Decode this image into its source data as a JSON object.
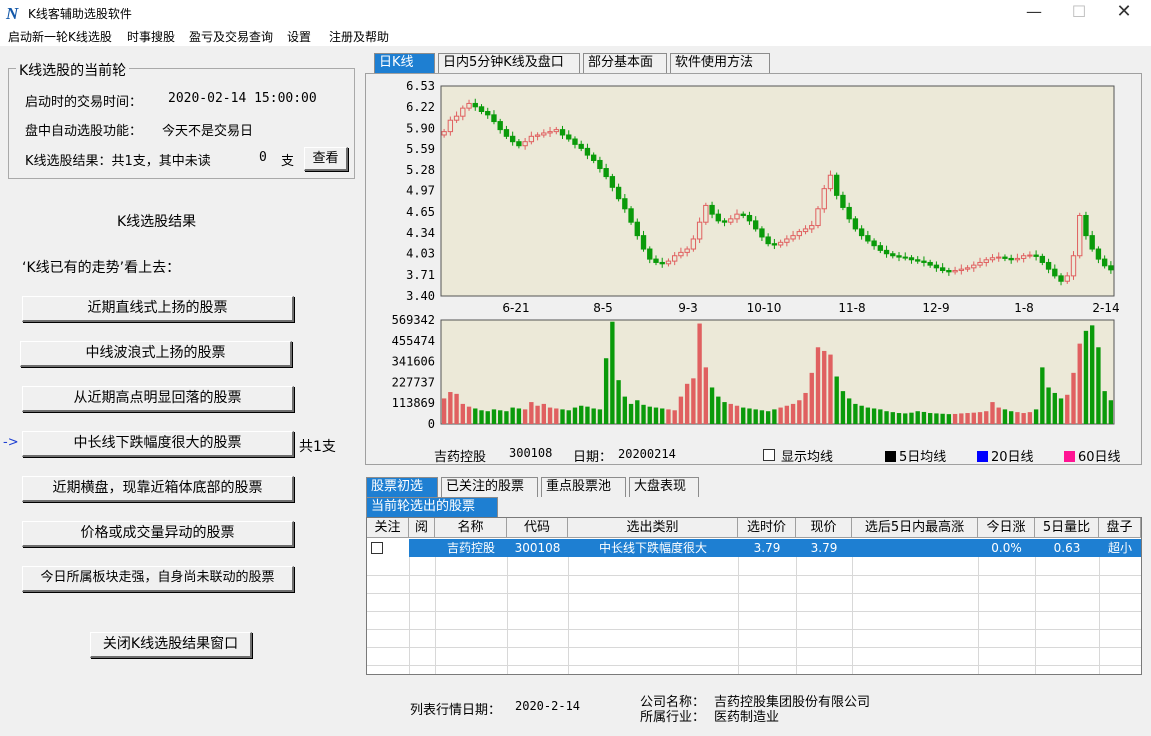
{
  "window": {
    "title": "K线客辅助选股软件",
    "logo": "N"
  },
  "menu": [
    "启动新一轮K线选股",
    "时事搜股",
    "盈亏及交易查询",
    "设置",
    "注册及帮助"
  ],
  "round": {
    "title": "K线选股的当前轮",
    "start_time_label": "启动时的交易时间：",
    "start_time": "2020-02-14 15:00:00",
    "auto_label": "盘中自动选股功能：",
    "auto_value": "今天不是交易日",
    "result_label": "K线选股结果：共1支，其中未读",
    "unread": "0",
    "unit": "支",
    "view_button": "查看"
  },
  "results": {
    "title": "K线选股结果",
    "intro": "‘K线已有的走势’看上去：",
    "marker": "->",
    "buttons": [
      {
        "label": "近期直线式上扬的股票",
        "count": ""
      },
      {
        "label": "中线波浪式上扬的股票",
        "count": ""
      },
      {
        "label": "从近期高点明显回落的股票",
        "count": ""
      },
      {
        "label": "中长线下跌幅度很大的股票",
        "count": "共1支"
      },
      {
        "label": "近期横盘，现靠近箱体底部的股票",
        "count": ""
      },
      {
        "label": "价格或成交量异动的股票",
        "count": ""
      },
      {
        "label": "今日所属板块走强，自身尚未联动的股票",
        "count": ""
      }
    ],
    "close_button": "关闭K线选股结果窗口"
  },
  "chart_tabs": [
    "日K线",
    "日内5分钟K线及盘口",
    "部分基本面",
    "软件使用方法"
  ],
  "chart_info": {
    "name": "吉药控股",
    "code": "300108",
    "date_label": "日期：",
    "date": "20200214",
    "show_ma": "显示均线",
    "ma5": "5日均线",
    "ma20": "20日线",
    "ma60": "60日线"
  },
  "colors": {
    "up": "#e06060",
    "down": "#0a9a0a",
    "plot_bg": "#ece9d8",
    "ma5": "#000000",
    "ma20": "#0000ff",
    "ma60": "#ff1493",
    "accent": "#1e7fd2"
  },
  "chart_data": [
    {
      "type": "candlestick",
      "y_ticks": [
        "6.53",
        "6.22",
        "5.90",
        "5.59",
        "5.28",
        "4.97",
        "4.65",
        "4.34",
        "4.03",
        "3.71",
        "3.40"
      ],
      "ylim": [
        3.4,
        6.53
      ],
      "x_ticks": [
        "6-21",
        "8-5",
        "9-3",
        "10-10",
        "11-8",
        "12-9",
        "1-8",
        "2-14"
      ],
      "close": [
        5.85,
        6.02,
        6.08,
        6.2,
        6.27,
        6.22,
        6.15,
        6.1,
        6.0,
        5.88,
        5.78,
        5.7,
        5.64,
        5.7,
        5.78,
        5.8,
        5.83,
        5.85,
        5.88,
        5.8,
        5.74,
        5.66,
        5.6,
        5.5,
        5.42,
        5.3,
        5.18,
        5.02,
        4.85,
        4.7,
        4.5,
        4.3,
        4.1,
        3.95,
        3.9,
        3.88,
        3.92,
        4.0,
        4.05,
        4.1,
        4.25,
        4.5,
        4.75,
        4.62,
        4.52,
        4.5,
        4.55,
        4.62,
        4.6,
        4.52,
        4.4,
        4.28,
        4.18,
        4.16,
        4.2,
        4.25,
        4.3,
        4.36,
        4.4,
        4.45,
        4.7,
        5.0,
        5.2,
        4.9,
        4.72,
        4.55,
        4.4,
        4.3,
        4.22,
        4.15,
        4.08,
        4.03,
        4.0,
        3.98,
        3.97,
        3.94,
        3.92,
        3.9,
        3.86,
        3.82,
        3.78,
        3.76,
        3.78,
        3.8,
        3.82,
        3.86,
        3.9,
        3.94,
        3.97,
        3.98,
        3.96,
        3.94,
        3.96,
        4.0,
        4.01,
        3.99,
        3.9,
        3.8,
        3.7,
        3.62,
        3.7,
        4.0,
        4.6,
        4.3,
        4.1,
        3.95,
        3.85,
        3.79
      ],
      "volume_y_ticks": [
        "569342",
        "455474",
        "341606",
        "227737",
        "113869",
        "0"
      ],
      "volume_ylim": [
        0,
        569342
      ],
      "volume": [
        140000,
        175000,
        165000,
        110000,
        95000,
        85000,
        75000,
        70000,
        80000,
        75000,
        70000,
        90000,
        85000,
        80000,
        120000,
        100000,
        110000,
        90000,
        85000,
        80000,
        75000,
        90000,
        100000,
        95000,
        85000,
        80000,
        360000,
        560000,
        240000,
        150000,
        110000,
        130000,
        105000,
        95000,
        90000,
        85000,
        80000,
        75000,
        150000,
        220000,
        250000,
        550000,
        310000,
        200000,
        150000,
        120000,
        110000,
        100000,
        90000,
        85000,
        80000,
        75000,
        70000,
        80000,
        90000,
        100000,
        110000,
        130000,
        170000,
        280000,
        420000,
        400000,
        380000,
        260000,
        180000,
        140000,
        110000,
        100000,
        90000,
        85000,
        80000,
        70000,
        65000,
        60000,
        58000,
        62000,
        70000,
        66000,
        60000,
        58000,
        56000,
        54000,
        55000,
        58000,
        60000,
        62000,
        65000,
        70000,
        120000,
        90000,
        80000,
        70000,
        65000,
        60000,
        65000,
        80000,
        310000,
        200000,
        170000,
        140000,
        160000,
        280000,
        440000,
        510000,
        540000,
        420000,
        180000,
        130000
      ]
    }
  ],
  "bottom_tabs": [
    "股票初选",
    "已关注的股票",
    "重点股票池",
    "大盘表现"
  ],
  "sub_tab": "当前轮选出的股票",
  "table": {
    "columns": [
      "关注",
      "阅",
      "名称",
      "代码",
      "选出类别",
      "选时价",
      "现价",
      "选后5日内最高涨",
      "今日涨",
      "5日量比",
      "盘子"
    ],
    "rows": [
      [
        "",
        "",
        "吉药控股",
        "300108",
        "中长线下跌幅度很大",
        "3.79",
        "3.79",
        "",
        "0.0%",
        "0.63",
        "超小"
      ]
    ]
  },
  "footer": {
    "date_label": "列表行情日期：",
    "date": "2020-2-14",
    "company_label": "公司名称：",
    "company": "吉药控股集团股份有限公司",
    "industry_label": "所属行业：",
    "industry": "医药制造业"
  }
}
